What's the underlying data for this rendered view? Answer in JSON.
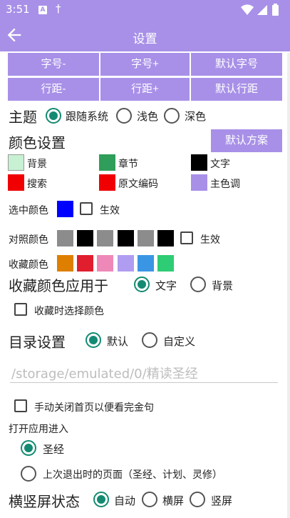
{
  "status_bar": {
    "time": "3:51",
    "notif_a": "A",
    "notif_cross": "†"
  },
  "app_bar": {
    "title": "设置"
  },
  "font_buttons": {
    "font_minus": "字号-",
    "font_plus": "字号+",
    "font_default": "默认字号",
    "line_minus": "行距-",
    "line_plus": "行距+",
    "line_default": "默认行距"
  },
  "theme": {
    "label": "主题",
    "options": [
      "跟随系统",
      "浅色",
      "深色"
    ],
    "selected": "跟随系统"
  },
  "color_settings": {
    "title": "颜色设置",
    "default_scheme": "默认方案",
    "items": [
      {
        "label": "背景",
        "color": "#c8f0d2"
      },
      {
        "label": "章节",
        "color": "#2f9e5a"
      },
      {
        "label": "文字",
        "color": "#000000"
      },
      {
        "label": "搜索",
        "color": "#f00000"
      },
      {
        "label": "原文编码",
        "color": "#f00000"
      },
      {
        "label": "主色调",
        "color": "#a890e8"
      }
    ]
  },
  "selection_color": {
    "label": "选中颜色",
    "color": "#0000ff",
    "effective_label": "生效"
  },
  "contrast_color": {
    "label": "对照颜色",
    "colors": [
      "#8c8c8c",
      "#000000",
      "#8c8c8c",
      "#000000",
      "#8c8c8c",
      "#000000"
    ],
    "effective_label": "生效"
  },
  "favorite_color": {
    "label": "收藏颜色",
    "colors": [
      "#de7f00",
      "#e01e2e",
      "#ee88b8",
      "#b09cf0",
      "#3a96e4",
      "#2ecc74"
    ]
  },
  "favorite_apply": {
    "label": "收藏颜色应用于",
    "options": [
      "文字",
      "背景"
    ],
    "selected": "文字",
    "choose_on_favorite": "收藏时选择颜色"
  },
  "toc": {
    "label": "目录设置",
    "options": [
      "默认",
      "自定义"
    ],
    "selected": "默认",
    "path_placeholder": "/storage/emulated/0/精读圣经"
  },
  "manual_close": {
    "label": "手动关闭首页以便看完金句"
  },
  "open_app": {
    "label": "打开应用进入",
    "options": [
      "圣经",
      "上次退出时的页面（圣经、计划、灵修）"
    ],
    "selected": "圣经"
  },
  "orientation": {
    "label": "横竖屏状态",
    "options": [
      "自动",
      "横屏",
      "竖屏"
    ],
    "selected": "自动"
  },
  "colors": {
    "accent": "#a890e8",
    "radio_on": "#148a72"
  }
}
